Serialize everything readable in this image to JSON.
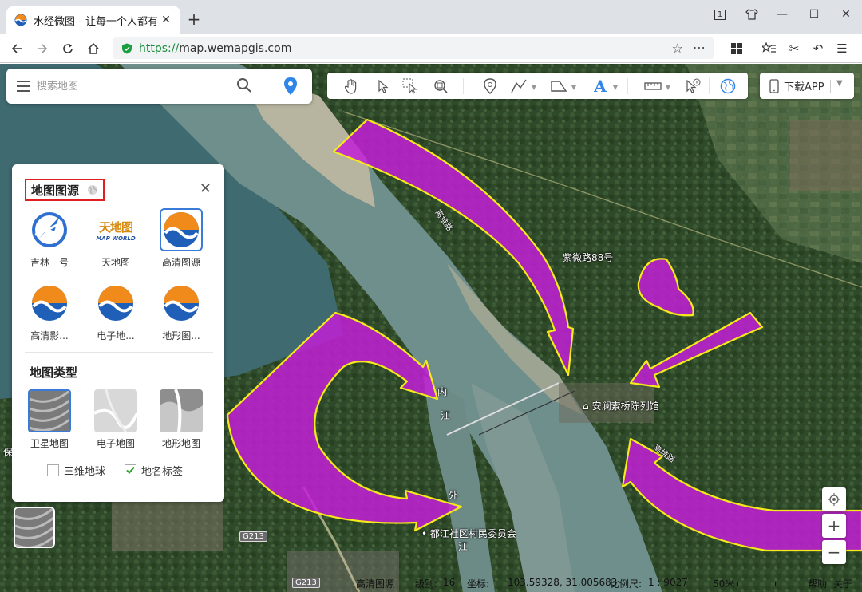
{
  "browser": {
    "tab_title": "水经微图 - 让每一个人都有自",
    "url_scheme": "https://",
    "url_host": "map.wemapgis.com",
    "window_badge": "1"
  },
  "search": {
    "placeholder": "搜索地图"
  },
  "download": {
    "label": "下载APP"
  },
  "panel": {
    "title": "地图图源",
    "sources": [
      {
        "label": "吉林一号",
        "icon": "jilin1-logo-icon",
        "selected": false
      },
      {
        "label": "天地图",
        "icon": "tianditu-logo-icon",
        "selected": false
      },
      {
        "label": "高清图源",
        "icon": "wave-logo-icon",
        "selected": true
      },
      {
        "label": "高清影...",
        "icon": "wave-logo-icon",
        "selected": false
      },
      {
        "label": "电子地...",
        "icon": "wave-logo-icon",
        "selected": false
      },
      {
        "label": "地形图...",
        "icon": "wave-logo-icon",
        "selected": false
      }
    ],
    "tianditu_logo_text": "天地图",
    "tianditu_logo_sub": "MAP WORLD",
    "types_title": "地图类型",
    "types": [
      {
        "label": "卫星地图",
        "selected": true
      },
      {
        "label": "电子地图",
        "selected": false
      },
      {
        "label": "地形地图",
        "selected": false
      }
    ],
    "options": [
      {
        "label": "三维地球",
        "checked": false
      },
      {
        "label": "地名标签",
        "checked": true
      }
    ]
  },
  "map_labels": {
    "road1": "紫微路88号",
    "poi1": "安澜索桥陈列馆",
    "poi2": "都江社区村民委员会",
    "road_g213_a": "G213",
    "road_g213_b": "G213",
    "river_a": "内",
    "river_b": "江",
    "river_c": "外",
    "river_d": "江",
    "left_edge": "保",
    "road_tag_top": "离堆路",
    "road_tag_right": "离堆路"
  },
  "status": {
    "source": "高清图源",
    "level_label": "级别:",
    "level": "16",
    "coord_label": "坐标:",
    "coords": "103.59328, 31.005683",
    "scale_label": "比例尺:",
    "scale": "1 : 9027",
    "scale_bar": "50米",
    "help": "帮助",
    "about": "关于"
  },
  "colors": {
    "arrow_fill": "#c21fd6",
    "arrow_stroke": "#f5ea1a",
    "accent_blue": "#2f86e8",
    "highlight_red": "#e02020",
    "url_green": "#1a8d3e"
  }
}
